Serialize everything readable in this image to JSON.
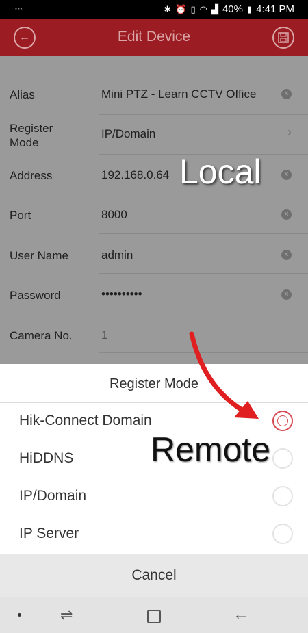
{
  "status_bar": {
    "battery": "40%",
    "time": "4:41 PM"
  },
  "app_bar": {
    "title": "Edit Device",
    "back_icon": "circle-arrow-left-icon",
    "save_icon": "circle-save-icon"
  },
  "form": {
    "rows": [
      {
        "label": "Alias",
        "value": "Mini PTZ - Learn CCTV Office"
      },
      {
        "label": "Register\nMode",
        "value": "IP/Domain"
      },
      {
        "label": "Address",
        "value": "192.168.0.64"
      },
      {
        "label": "Port",
        "value": "8000"
      },
      {
        "label": "User Name",
        "value": "admin"
      },
      {
        "label": "Password",
        "value": "••••••••••"
      },
      {
        "label": "Camera No.",
        "value": "1"
      }
    ]
  },
  "annotations": {
    "local": "Local",
    "remote": "Remote",
    "arrow_color": "#e02020"
  },
  "register_sheet": {
    "title": "Register Mode",
    "options": [
      {
        "label": "Hik-Connect Domain",
        "selected": true
      },
      {
        "label": "HiDDNS",
        "selected": false
      },
      {
        "label": "IP/Domain",
        "selected": false
      },
      {
        "label": "IP Server",
        "selected": false
      }
    ],
    "cancel": "Cancel"
  },
  "colors": {
    "brand_red": "#9b1d23",
    "radio_selected": "#d64a52"
  }
}
